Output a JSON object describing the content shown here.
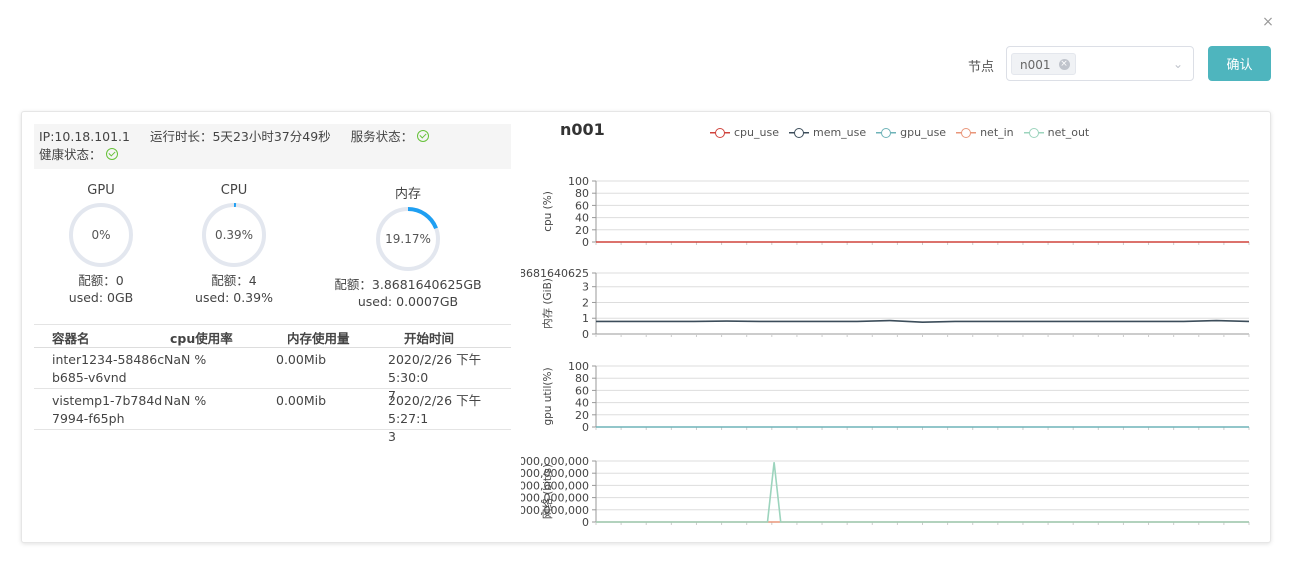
{
  "header": {
    "node_label": "节点",
    "selected_node": "n001",
    "tag_close_glyph": "×",
    "confirm_label": "确认",
    "close_glyph": "×"
  },
  "info": {
    "ip": "IP:10.18.101.1",
    "uptime": "运行时长：5天23小时37分49秒",
    "service_status": "服务状态：",
    "health_status": "健康状态："
  },
  "gauges": [
    {
      "title": "GPU",
      "value": 0,
      "pct": "0%",
      "alloc": "配额：0",
      "used": "used: 0GB"
    },
    {
      "title": "CPU",
      "value": 0.39,
      "pct": "0.39%",
      "alloc": "配额：4",
      "used": "used: 0.39%"
    },
    {
      "title": "内存",
      "value": 19.17,
      "pct": "19.17%",
      "alloc": "配额：3.8681640625GB",
      "used": "used: 0.0007GB"
    }
  ],
  "colors": {
    "gauge_bg": "#e3e7ef",
    "gauge_fill": "#1e9ff2",
    "confirm_bg": "#4eb5be",
    "ok_green": "#67c23a"
  },
  "table": {
    "headers": [
      "容器名",
      "cpu使用率",
      "内存使用量",
      "开始时间"
    ],
    "rows": [
      {
        "name_l1": "inter1234-58486c",
        "name_l2": "b685-v6vnd",
        "cpu": "NaN %",
        "mem": "0.00Mib",
        "time_l1": "2020/2/26 下午5:30:0",
        "time_l2": "7"
      },
      {
        "name_l1": "vistemp1-7b784d",
        "name_l2": "7994-f65ph",
        "cpu": "NaN %",
        "mem": "0.00Mib",
        "time_l1": "2020/2/26 下午5:27:1",
        "time_l2": "3"
      }
    ]
  },
  "chart_data": {
    "type": "line",
    "title": "n001",
    "legend": [
      {
        "name": "cpu_use",
        "color": "#d0433c"
      },
      {
        "name": "mem_use",
        "color": "#3c4d5a"
      },
      {
        "name": "gpu_use",
        "color": "#6eb3b8"
      },
      {
        "name": "net_in",
        "color": "#e9967a"
      },
      {
        "name": "net_out",
        "color": "#9cd4bd"
      }
    ],
    "legend_position": "top",
    "grid": true,
    "panels": [
      {
        "ylabel": "cpu (%)",
        "ylim": [
          0,
          100
        ],
        "ticks": [
          "100",
          "80",
          "60",
          "40",
          "20",
          "0"
        ],
        "series": [
          {
            "name": "cpu_use",
            "color": "#d0433c",
            "values": [
              0,
              0,
              0,
              0,
              0,
              0,
              0,
              0,
              0,
              0,
              0,
              0,
              0,
              0,
              0,
              0,
              0,
              0,
              0,
              0
            ]
          }
        ]
      },
      {
        "ylabel": "内存 (GiB)",
        "ylim": [
          0,
          3.8681640625
        ],
        "ticks": [
          ".8681640625",
          "3",
          "2",
          "1",
          "0"
        ],
        "series": [
          {
            "name": "mem_use",
            "color": "#3c4d5a",
            "values": [
              0.8,
              0.8,
              0.8,
              0.8,
              0.82,
              0.8,
              0.8,
              0.8,
              0.8,
              0.85,
              0.75,
              0.8,
              0.8,
              0.8,
              0.8,
              0.8,
              0.8,
              0.8,
              0.8,
              0.85,
              0.8
            ]
          }
        ]
      },
      {
        "ylabel": "gpu util(%)",
        "ylim": [
          0,
          100
        ],
        "ticks": [
          "100",
          "80",
          "60",
          "40",
          "20",
          "0"
        ],
        "series": [
          {
            "name": "gpu_use",
            "color": "#6eb3b8",
            "values": [
              0,
              0,
              0,
              0,
              0,
              0,
              0,
              0,
              0,
              0,
              0,
              0,
              0,
              0,
              0,
              0,
              0,
              0,
              0,
              0
            ]
          }
        ]
      },
      {
        "ylabel": "网络 (bit/s)",
        "ylim": [
          0,
          5000000000
        ],
        "ticks": [
          ",000,000,000",
          ",000,000,000",
          ",000,000,000",
          ",000,000,000",
          ",000,000,000",
          "0"
        ],
        "series": [
          {
            "name": "net_in",
            "color": "#e9967a",
            "values": [
              0,
              0,
              0,
              0,
              0,
              0,
              0,
              0,
              0,
              0,
              0,
              0,
              0,
              0,
              0,
              0,
              0,
              0,
              0,
              0,
              0,
              0,
              0,
              0,
              0,
              0,
              0,
              0,
              0,
              0,
              0,
              0,
              0,
              0,
              0,
              0,
              0,
              0,
              0,
              0,
              0,
              0,
              0,
              0,
              0,
              0,
              0,
              0,
              0,
              0,
              0,
              0,
              0,
              0,
              0,
              0,
              0,
              0,
              0,
              0,
              0,
              0,
              0,
              0,
              0,
              0,
              0,
              0,
              0,
              0,
              0,
              0,
              0,
              0,
              0,
              0,
              0,
              0,
              0,
              0,
              0,
              0,
              0,
              0,
              0,
              0,
              0,
              0,
              0,
              0,
              0,
              0,
              0,
              0,
              0,
              0,
              0,
              0,
              0,
              0
            ]
          },
          {
            "name": "net_out",
            "color": "#9cd4bd",
            "values": [
              0,
              0,
              0,
              0,
              0,
              0,
              0,
              0,
              0,
              0,
              0,
              0,
              0,
              0,
              0,
              0,
              0,
              0,
              0,
              0,
              0,
              0,
              0,
              0,
              0,
              0,
              0,
              4900000000,
              0,
              0,
              0,
              0,
              0,
              0,
              0,
              0,
              0,
              0,
              0,
              0,
              0,
              0,
              0,
              0,
              0,
              0,
              0,
              0,
              0,
              0,
              0,
              0,
              0,
              0,
              0,
              0,
              0,
              0,
              0,
              0,
              0,
              0,
              0,
              0,
              0,
              0,
              0,
              0,
              0,
              0,
              0,
              0,
              0,
              0,
              0,
              0,
              0,
              0,
              0,
              0,
              0,
              0,
              0,
              0,
              0,
              0,
              0,
              0,
              0,
              0,
              0,
              0,
              0,
              0,
              0,
              0,
              0,
              0,
              0,
              0
            ]
          }
        ]
      }
    ]
  }
}
